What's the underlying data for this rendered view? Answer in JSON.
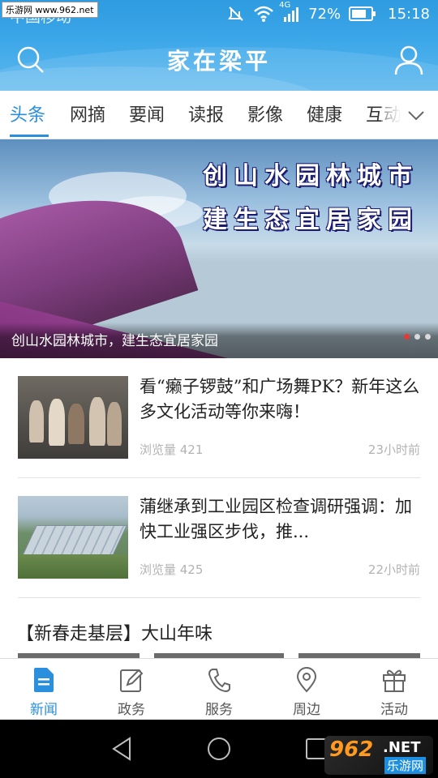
{
  "statusbar": {
    "carrier": "中国移动",
    "network": "4G",
    "battery": "72%",
    "time": "15:18",
    "watermark": "乐游网 www.962.net"
  },
  "header": {
    "title": "家在梁平"
  },
  "tabs": [
    {
      "label": "头条",
      "active": true
    },
    {
      "label": "网摘",
      "active": false
    },
    {
      "label": "要闻",
      "active": false
    },
    {
      "label": "读报",
      "active": false
    },
    {
      "label": "影像",
      "active": false
    },
    {
      "label": "健康",
      "active": false
    },
    {
      "label": "互动",
      "active": false
    }
  ],
  "banner": {
    "line1": "创山水园林城市",
    "line2": "建生态宜居家园",
    "caption": "创山水园林城市，建生态宜居家园",
    "slide_count": 3,
    "active_slide": 1
  },
  "news": [
    {
      "title": "看“癞子锣鼓”和广场舞PK？新年这么多文化活动等你来嗨！",
      "views": "浏览量 421",
      "time": "23小时前"
    },
    {
      "title": "蒲继承到工业园区检查调研强调：加快工业强区步伐，推...",
      "views": "浏览量 425",
      "time": "22小时前"
    }
  ],
  "section": {
    "heading": "【新春走基层】大山年味"
  },
  "bottom_nav": [
    {
      "label": "新闻",
      "icon": "news-icon",
      "active": true
    },
    {
      "label": "政务",
      "icon": "edit-icon",
      "active": false
    },
    {
      "label": "服务",
      "icon": "phone-icon",
      "active": false
    },
    {
      "label": "周边",
      "icon": "location-icon",
      "active": false
    },
    {
      "label": "活动",
      "icon": "gift-icon",
      "active": false
    }
  ],
  "watermark_br": {
    "logo": "962",
    "net": ".NET",
    "site": "乐游网"
  },
  "colors": {
    "accent": "#2a8fdc",
    "header_gradient_top": "#2f9be0",
    "slide_dot_active": "#e53935"
  }
}
